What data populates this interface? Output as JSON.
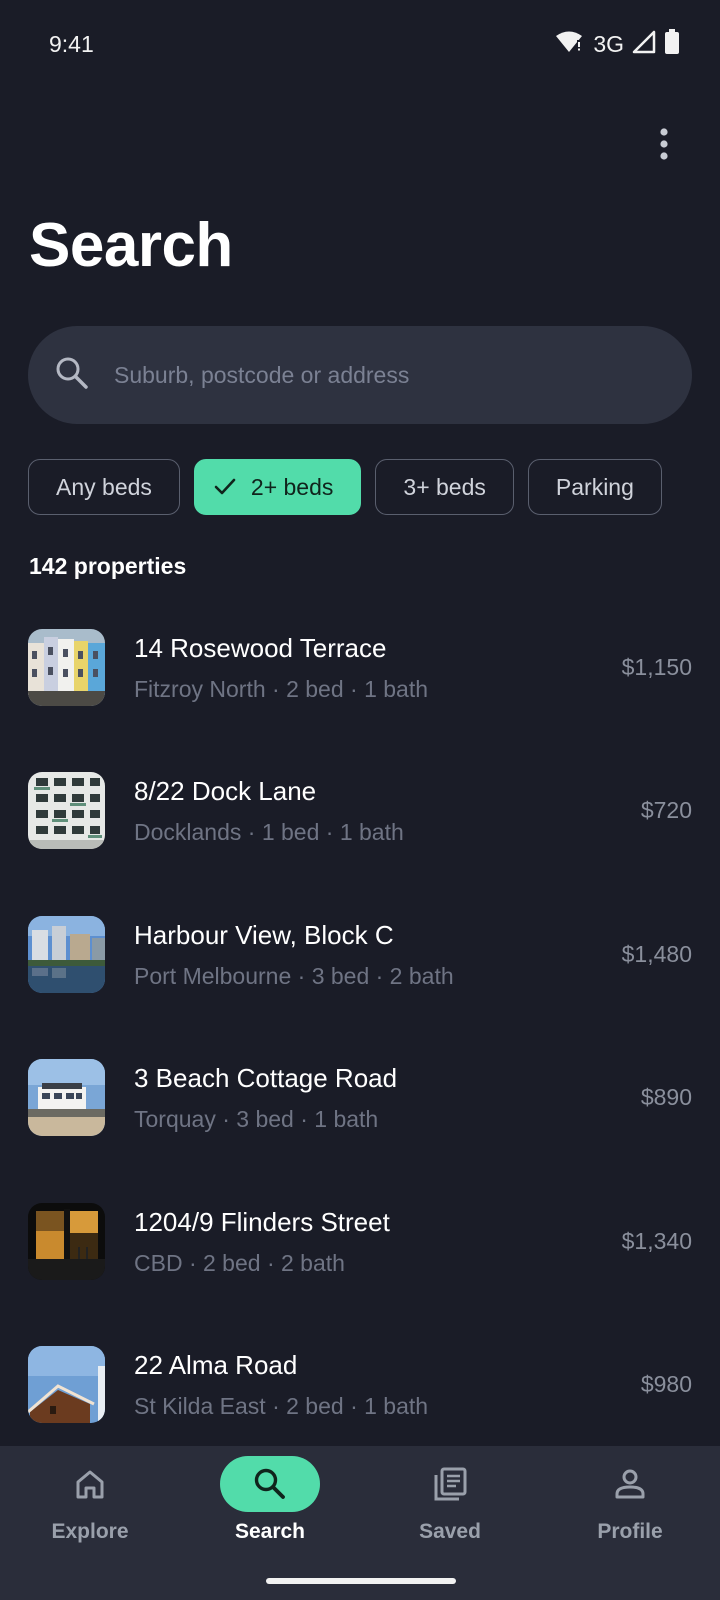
{
  "status_bar": {
    "time": "9:41",
    "network": "3G"
  },
  "header": {
    "title": "Search"
  },
  "search": {
    "placeholder": "Suburb, postcode or address"
  },
  "filters": [
    {
      "label": "Any beds",
      "selected": false
    },
    {
      "label": "2+ beds",
      "selected": true
    },
    {
      "label": "3+ beds",
      "selected": false
    },
    {
      "label": "Parking",
      "selected": false
    }
  ],
  "results": {
    "count_label": "142 properties",
    "items": [
      {
        "title": "14 Rosewood Terrace",
        "subtitle": "Fitzroy North · 2 bed · 1 bath",
        "price": "$1,150"
      },
      {
        "title": "8/22 Dock Lane",
        "subtitle": "Docklands · 1 bed · 1 bath",
        "price": "$720"
      },
      {
        "title": "Harbour View, Block C",
        "subtitle": "Port Melbourne · 3 bed · 2 bath",
        "price": "$1,480"
      },
      {
        "title": "3 Beach Cottage Road",
        "subtitle": "Torquay · 3 bed · 1 bath",
        "price": "$890"
      },
      {
        "title": "1204/9 Flinders Street",
        "subtitle": "CBD · 2 bed · 2 bath",
        "price": "$1,340"
      },
      {
        "title": "22 Alma Road",
        "subtitle": "St Kilda East · 2 bed · 1 bath",
        "price": "$980"
      }
    ]
  },
  "bottom_nav": [
    {
      "label": "Explore",
      "icon": "home-icon",
      "active": false
    },
    {
      "label": "Search",
      "icon": "search-icon",
      "active": true
    },
    {
      "label": "Saved",
      "icon": "saved-icon",
      "active": false
    },
    {
      "label": "Profile",
      "icon": "person-icon",
      "active": false
    }
  ],
  "colors": {
    "accent": "#52dcaa",
    "background": "#1a1c27",
    "surface": "#2e3240"
  }
}
